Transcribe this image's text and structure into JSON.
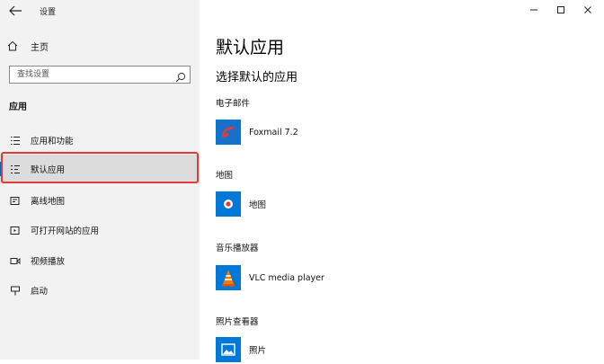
{
  "window": {
    "title": "设置"
  },
  "sidebar": {
    "home_label": "主页",
    "search_placeholder": "查找设置",
    "section": "应用",
    "items": [
      {
        "label": "应用和功能",
        "icon": "list-icon"
      },
      {
        "label": "默认应用",
        "icon": "default-apps-icon",
        "selected": true
      },
      {
        "label": "离线地图",
        "icon": "map-icon"
      },
      {
        "label": "可打开网站的应用",
        "icon": "web-apps-icon"
      },
      {
        "label": "视频播放",
        "icon": "video-icon"
      },
      {
        "label": "启动",
        "icon": "startup-icon"
      }
    ]
  },
  "main": {
    "title": "默认应用",
    "subtitle": "选择默认的应用",
    "categories": [
      {
        "label": "电子邮件",
        "app": "Foxmail 7.2",
        "icon": "foxmail-icon"
      },
      {
        "label": "地图",
        "app": "地图",
        "icon": "maps-app-icon"
      },
      {
        "label": "音乐播放器",
        "app": "VLC media player",
        "icon": "vlc-icon"
      },
      {
        "label": "照片查看器",
        "app": "照片",
        "icon": "photos-icon"
      }
    ]
  },
  "colors": {
    "accent": "#0063b1",
    "tile_blue": "#0078d7",
    "highlight": "#e13a3a"
  }
}
